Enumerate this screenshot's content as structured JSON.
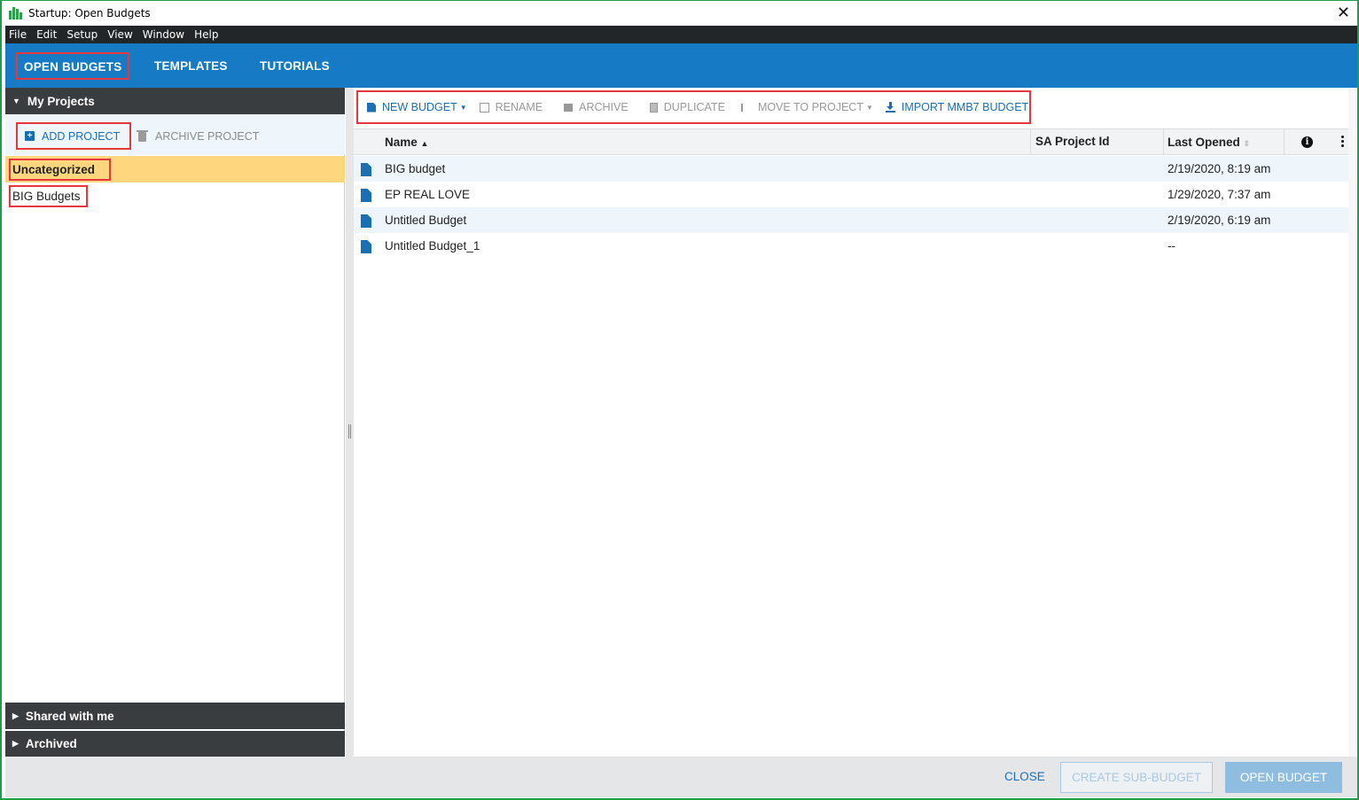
{
  "window": {
    "title": "Startup: Open Budgets",
    "close_glyph": "✕"
  },
  "menu": [
    "File",
    "Edit",
    "Setup",
    "View",
    "Window",
    "Help"
  ],
  "nav": {
    "tabs": [
      "OPEN BUDGETS",
      "TEMPLATES",
      "TUTORIALS"
    ],
    "active": "OPEN BUDGETS"
  },
  "sidebar": {
    "my_projects": "My Projects",
    "add_project": "ADD PROJECT",
    "archive_project": "ARCHIVE PROJECT",
    "projects": [
      "Uncategorized",
      "BIG Budgets"
    ],
    "selected": "Uncategorized",
    "shared": "Shared with me",
    "archived": "Archived"
  },
  "toolbar": {
    "new_budget": "NEW BUDGET",
    "rename": "RENAME",
    "archive": "ARCHIVE",
    "duplicate": "DUPLICATE",
    "move_to_project": "MOVE TO PROJECT",
    "import": "IMPORT MMB7 BUDGET"
  },
  "table": {
    "columns": {
      "name": "Name",
      "sa_project_id": "SA Project Id",
      "last_opened": "Last Opened"
    },
    "rows": [
      {
        "name": "BIG budget",
        "sa_project_id": "",
        "last_opened": "2/19/2020, 8:19 am"
      },
      {
        "name": "EP REAL LOVE",
        "sa_project_id": "",
        "last_opened": "1/29/2020, 7:37 am"
      },
      {
        "name": "Untitled Budget",
        "sa_project_id": "",
        "last_opened": "2/19/2020, 6:19 am"
      },
      {
        "name": "Untitled Budget_1",
        "sa_project_id": "",
        "last_opened": "--"
      }
    ]
  },
  "footer": {
    "close": "CLOSE",
    "create_sub": "CREATE SUB-BUDGET",
    "open": "OPEN BUDGET"
  },
  "colors": {
    "nav_blue": "#167bc4",
    "accent_blue": "#1a6fb3",
    "selected_row": "#fdd67e",
    "highlight_red": "#e8363e"
  }
}
